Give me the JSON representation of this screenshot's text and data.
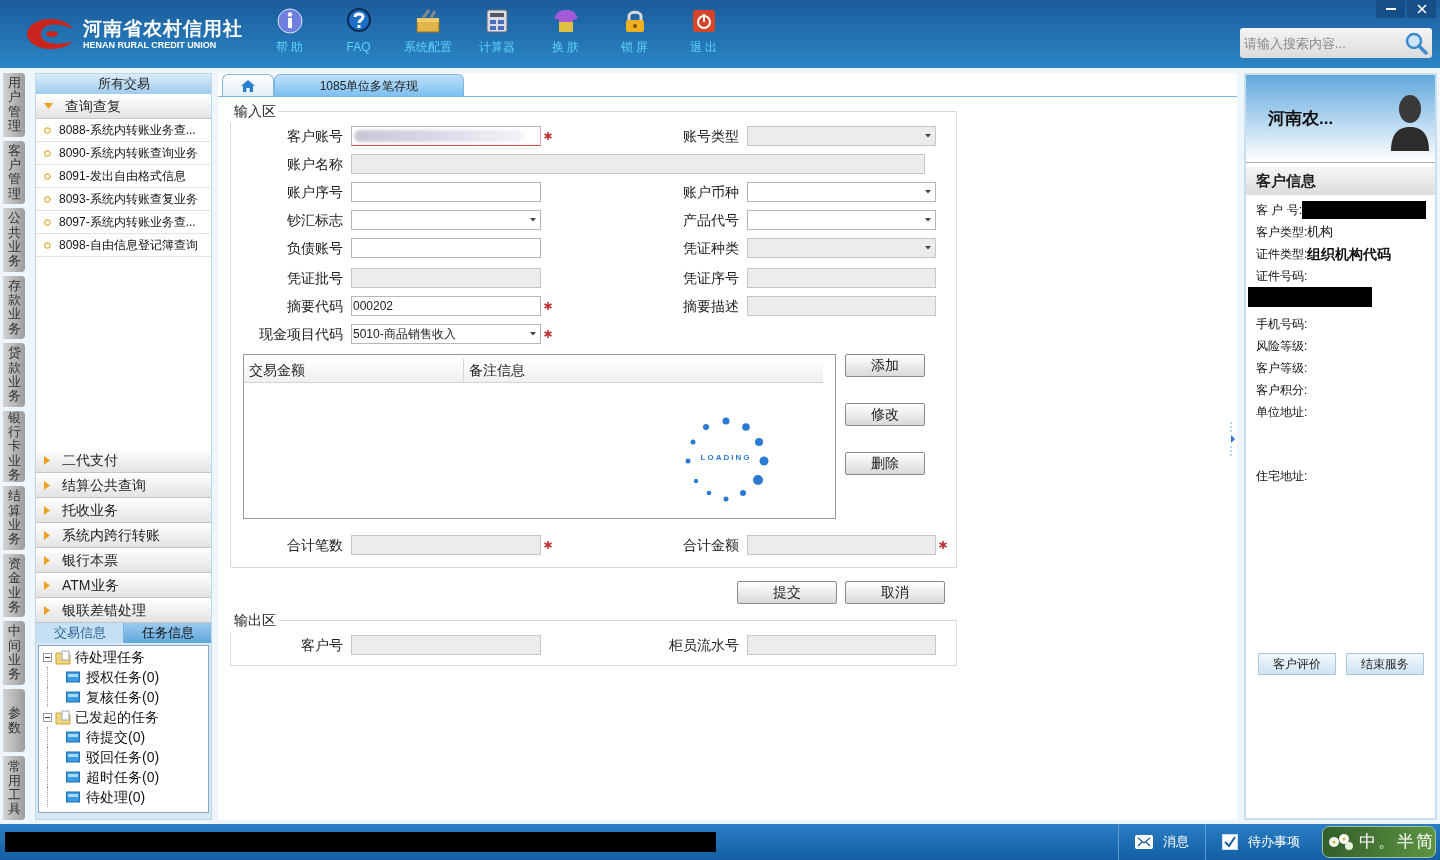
{
  "app": {
    "logo_cn": "河南省农村信用社",
    "logo_en": "HENAN RURAL CREDIT UNION"
  },
  "toolbar": [
    {
      "label": "帮 助",
      "kind": "info"
    },
    {
      "label": "FAQ",
      "kind": "faq"
    },
    {
      "label": "系统配置",
      "kind": "config"
    },
    {
      "label": "计算器",
      "kind": "calculator"
    },
    {
      "label": "换 肤",
      "kind": "skin"
    },
    {
      "label": "锁 屏",
      "kind": "lock"
    },
    {
      "label": "退 出",
      "kind": "exit"
    }
  ],
  "search": {
    "placeholder": "请输入搜索内容..."
  },
  "nav_tabs": [
    "用户管理",
    "客户管理",
    "公共业务",
    "存款业务",
    "贷款业务",
    "银行卡业务",
    "结算业务",
    "资金业务",
    "中间业务",
    "参数",
    "常用工具"
  ],
  "sidebar": {
    "title": "所有交易",
    "groups": [
      {
        "label": "查询查复",
        "expanded": true,
        "items": [
          "8088-系统内转账业务查...",
          "8090-系统内转账查询业务",
          "8091-发出自由格式信息",
          "8093-系统内转账查复业务",
          "8097-系统内转账业务查...",
          "8098-自由信息登记簿查询"
        ]
      },
      {
        "label": "二代支付",
        "expanded": false
      },
      {
        "label": "结算公共查询",
        "expanded": false
      },
      {
        "label": "托收业务",
        "expanded": false
      },
      {
        "label": "系统内跨行转账",
        "expanded": false
      },
      {
        "label": "银行本票",
        "expanded": false
      },
      {
        "label": "ATM业务",
        "expanded": false
      },
      {
        "label": "银联差错处理",
        "expanded": false
      }
    ],
    "bottom_tabs": [
      {
        "label": "交易信息",
        "selected": false
      },
      {
        "label": "任务信息",
        "selected": true
      }
    ],
    "task_tree": [
      {
        "label": "待处理任务",
        "expanded": true,
        "children": [
          {
            "label": "授权任务(0)"
          },
          {
            "label": "复核任务(0)"
          }
        ]
      },
      {
        "label": "已发起的任务",
        "expanded": true,
        "children": [
          {
            "label": "待提交(0)"
          },
          {
            "label": "驳回任务(0)"
          },
          {
            "label": "超时任务(0)"
          },
          {
            "label": "待处理(0)"
          }
        ]
      }
    ]
  },
  "tabs": [
    {
      "kind": "home",
      "selected": false
    },
    {
      "kind": "page",
      "label": "1085单位多笔存现",
      "selected": true
    }
  ],
  "input_section": {
    "title": "输入区",
    "rows": [
      [
        {
          "label": "客户账号",
          "kind": "text",
          "disabled": false,
          "required": true,
          "redacted": true,
          "error": true
        },
        {
          "label": "账号类型",
          "kind": "select",
          "disabled": true,
          "required": false
        }
      ],
      [
        {
          "label": "账户名称",
          "kind": "text",
          "disabled": true,
          "required": false,
          "wide": true
        }
      ],
      [
        {
          "label": "账户序号",
          "kind": "text",
          "disabled": false,
          "required": false
        },
        {
          "label": "账户币种",
          "kind": "select",
          "disabled": false,
          "required": false
        }
      ],
      [
        {
          "label": "钞汇标志",
          "kind": "select",
          "disabled": false,
          "required": false
        },
        {
          "label": "产品代号",
          "kind": "select",
          "disabled": false,
          "required": false
        }
      ],
      [
        {
          "label": "负债账号",
          "kind": "text",
          "disabled": false,
          "required": false
        },
        {
          "label": "凭证种类",
          "kind": "select",
          "disabled": true,
          "required": false
        }
      ],
      [
        {
          "label": "凭证批号",
          "kind": "text",
          "disabled": true,
          "required": false
        },
        {
          "label": "凭证序号",
          "kind": "text",
          "disabled": true,
          "required": false
        }
      ],
      [
        {
          "label": "摘要代码",
          "kind": "text",
          "disabled": false,
          "required": true,
          "value": "000202"
        },
        {
          "label": "摘要描述",
          "kind": "text",
          "disabled": true,
          "required": false
        }
      ],
      [
        {
          "label": "现金项目代码",
          "kind": "select",
          "disabled": false,
          "required": true,
          "value": "5010-商品销售收入"
        }
      ]
    ],
    "grid": {
      "columns": [
        "交易金额",
        "备注信息"
      ],
      "loading_text": "LOADING"
    },
    "grid_buttons": [
      "添加",
      "修改",
      "删除"
    ],
    "totals": [
      {
        "label": "合计笔数",
        "disabled": true,
        "required": true
      },
      {
        "label": "合计金额",
        "disabled": true,
        "required": true
      }
    ]
  },
  "actions": [
    "提交",
    "取消"
  ],
  "output_section": {
    "title": "输出区",
    "fields": [
      {
        "label": "客户号",
        "disabled": true,
        "required": false
      },
      {
        "label": "柜员流水号",
        "disabled": true,
        "required": false
      }
    ]
  },
  "customer_panel": {
    "name": "河南农...",
    "heading": "客户信息",
    "rows": [
      {
        "label": "客 户 号:",
        "redacted": true
      },
      {
        "label": "客户类型:",
        "value": "机构",
        "bold": false
      },
      {
        "label": "证件类型:",
        "value": "组织机构代码",
        "bold": true
      },
      {
        "label": "证件号码:",
        "redacted": true,
        "wrapped": true
      },
      {
        "label": "手机号码:"
      },
      {
        "label": "风险等级:"
      },
      {
        "label": "客户等级:"
      },
      {
        "label": "客户积分:"
      },
      {
        "label": "单位地址:"
      },
      {
        "label": "住宅地址:"
      }
    ],
    "buttons": [
      "客户评价",
      "结束服务"
    ]
  },
  "status_bar": {
    "redacted": true,
    "items": [
      {
        "label": "消息",
        "kind": "mail"
      },
      {
        "label": "待办事项",
        "kind": "todo"
      }
    ],
    "ime": "中。半简"
  }
}
